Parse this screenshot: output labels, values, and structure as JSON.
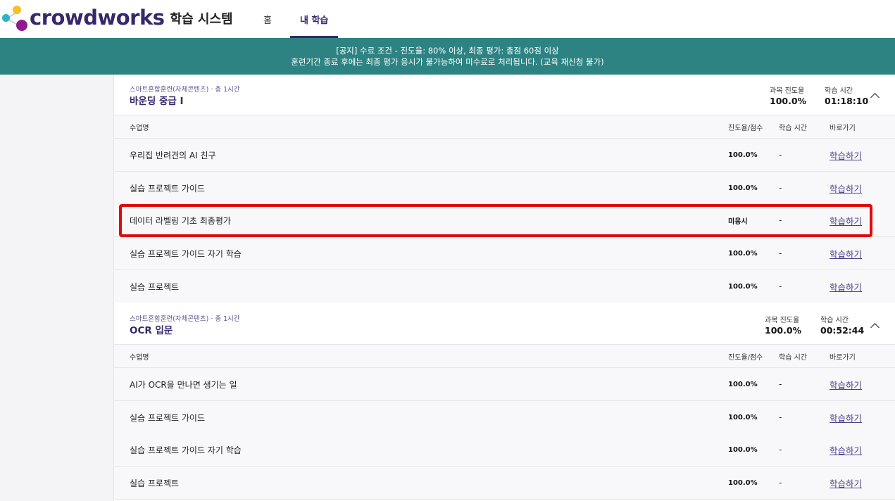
{
  "header": {
    "logo_text": "crowdworks",
    "system_title": "학습 시스템",
    "nav": [
      {
        "label": "홈"
      },
      {
        "label": "내 학습"
      }
    ]
  },
  "banner": {
    "line1": "[공지] 수료 조건 - 진도율: 80% 이상, 최종 평가: 총점 60점 이상",
    "line2": "훈련기간 종료 후에는 최종 평가 응시가 불가능하여 미수료로 처리됩니다. (교육 재신청 불가)"
  },
  "columns": {
    "name": "수업명",
    "progress": "진도율/점수",
    "time": "학습 시간",
    "go": "바로가기"
  },
  "courses": [
    {
      "meta": "스마트혼합훈련(자체콘텐츠) · 총 1시간",
      "title": "바운딩 중급 I",
      "progress_label": "과목 진도율",
      "progress_value": "100.0%",
      "time_label": "학습 시간",
      "time_value": "01:18:10",
      "lessons": [
        {
          "name": "우리집 반려견의 AI 친구",
          "progress": "100.0%",
          "time": "-",
          "go": "학습하기"
        },
        {
          "name": "실습 프로젝트 가이드",
          "progress": "100.0%",
          "time": "-",
          "go": "학습하기"
        },
        {
          "name": "데이터 라벨링 기초 최종평가",
          "progress": "미응시",
          "time": "-",
          "go": "학습하기"
        },
        {
          "name": "실습 프로젝트 가이드 자기 학습",
          "progress": "100.0%",
          "time": "-",
          "go": "학습하기"
        },
        {
          "name": "실습 프로젝트",
          "progress": "100.0%",
          "time": "-",
          "go": "학습하기"
        }
      ]
    },
    {
      "meta": "스마트혼합훈련(자체콘텐츠) · 총 1시간",
      "title": "OCR 입문",
      "progress_label": "과목 진도율",
      "progress_value": "100.0%",
      "time_label": "학습 시간",
      "time_value": "00:52:44",
      "lessons": [
        {
          "name": "AI가 OCR을 만나면 생기는 일",
          "progress": "100.0%",
          "time": "-",
          "go": "학습하기"
        },
        {
          "name": "실습 프로젝트 가이드",
          "progress": "100.0%",
          "time": "-",
          "go": "학습하기"
        },
        {
          "name": "실습 프로젝트 가이드 자기 학습",
          "progress": "100.0%",
          "time": "-",
          "go": "학습하기"
        },
        {
          "name": "실습 프로젝트",
          "progress": "100.0%",
          "time": "-",
          "go": "학습하기"
        }
      ]
    }
  ],
  "colors": {
    "brand": "#36286b",
    "banner": "#2d8282",
    "highlight": "#e00a0a"
  }
}
